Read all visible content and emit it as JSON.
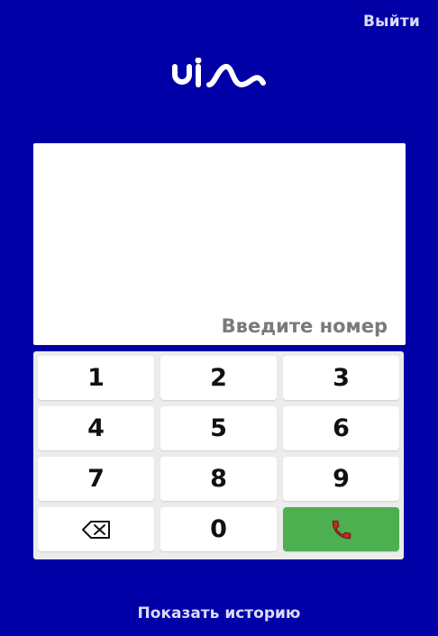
{
  "header": {
    "logout_label": "Выйти"
  },
  "brand": {
    "logo_icon": "uis-logo-icon",
    "logo_color": "#ffffff"
  },
  "display": {
    "value": "",
    "placeholder": "Введите номер"
  },
  "keypad": {
    "keys": [
      "1",
      "2",
      "3",
      "4",
      "5",
      "6",
      "7",
      "8",
      "9",
      "",
      "0",
      ""
    ],
    "backspace_icon": "backspace-icon",
    "call_icon": "phone-icon",
    "call_color": "#4caf50",
    "call_icon_color": "#c62828"
  },
  "footer": {
    "history_label": "Показать историю"
  },
  "colors": {
    "background": "#0000a6",
    "panel": "#ececec",
    "key": "#ffffff"
  }
}
